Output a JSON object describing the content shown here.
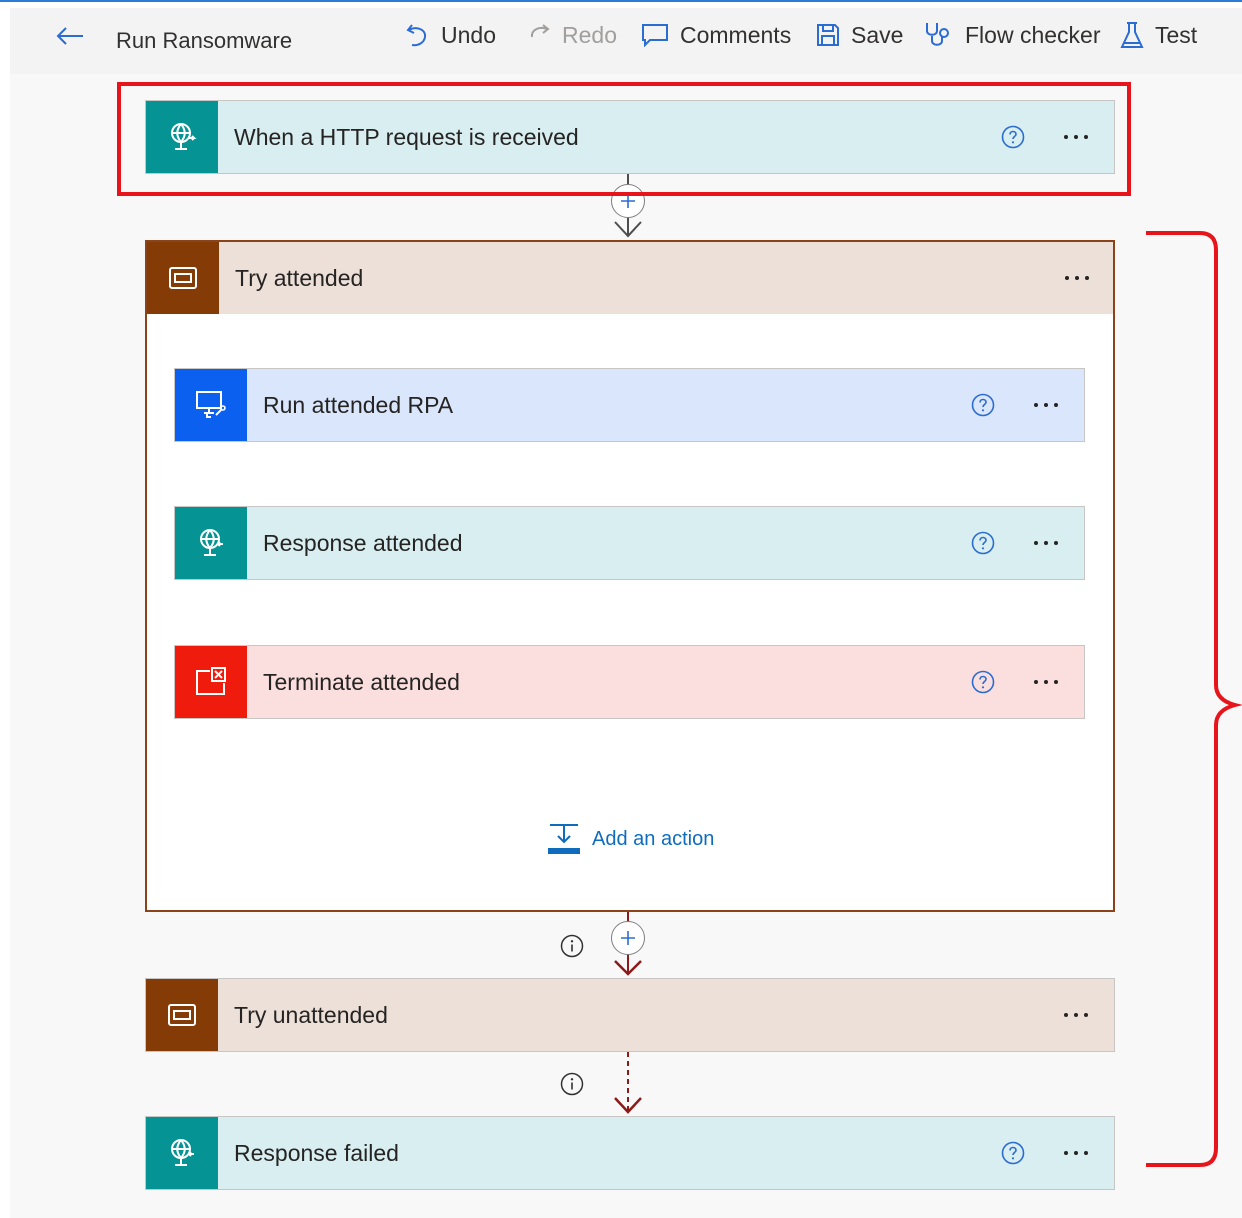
{
  "toolbar": {
    "flow_name": "Run Ransomware",
    "undo_label": "Undo",
    "redo_label": "Redo",
    "comments_label": "Comments",
    "save_label": "Save",
    "flow_checker_label": "Flow checker",
    "test_label": "Test"
  },
  "flow": {
    "trigger": {
      "title": "When a HTTP request is received"
    },
    "try_attended": {
      "title": "Try attended",
      "actions": [
        {
          "title": "Run attended RPA"
        },
        {
          "title": "Response attended"
        },
        {
          "title": "Terminate attended"
        }
      ],
      "add_action_label": "Add an action"
    },
    "try_unattended": {
      "title": "Try unattended"
    },
    "response_failed": {
      "title": "Response failed"
    }
  },
  "colors": {
    "accent": "#0f6cbd",
    "http_teal": "#069393",
    "rpa_blue": "#0c60f0",
    "terminate_red": "#ef1b0c",
    "scope_brown": "#843b06",
    "annotation_red": "#e8141b"
  },
  "icons": [
    "back-arrow-icon",
    "undo-icon",
    "redo-icon",
    "comment-icon",
    "save-icon",
    "stethoscope-icon",
    "flask-icon",
    "http-globe-icon",
    "scope-icon",
    "rpa-desktop-icon",
    "terminate-icon",
    "help-icon",
    "more-icon",
    "add-action-icon",
    "plus-icon",
    "info-icon"
  ]
}
